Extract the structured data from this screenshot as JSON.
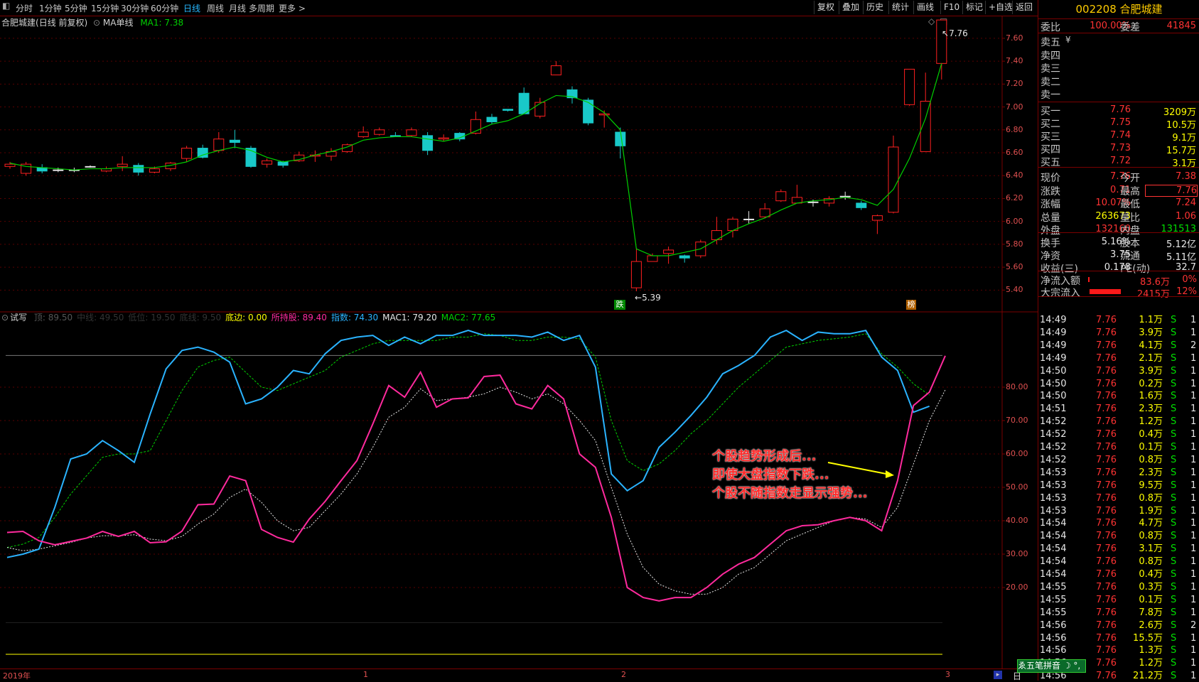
{
  "toolbar": {
    "tabs": [
      "分时",
      "1分钟",
      "5分钟",
      "15分钟",
      "30分钟",
      "60分钟",
      "日线",
      "周线",
      "月线",
      "多周期",
      "更多 >"
    ],
    "active_tab": "日线",
    "right_buttons": [
      "复权",
      "叠加",
      "历史",
      "统计",
      "画线",
      "F10",
      "标记",
      "+自选",
      "返回"
    ]
  },
  "main_chart": {
    "stock_name": "合肥城建",
    "period_label": "(日线 前复权)",
    "ma_label": "MA单线",
    "ma_value_label": "MA1: 7.38",
    "price_ticks": [
      "7.60",
      "7.40",
      "7.20",
      "7.00",
      "6.80",
      "6.60",
      "6.40",
      "6.20",
      "6.00",
      "5.80",
      "5.60",
      "5.40"
    ],
    "high_marker": "7.76",
    "low_marker": "5.39",
    "badge_down": "跌",
    "badge_rank": "榜",
    "colors": {
      "up": "#ff2020",
      "down": "#19c9c9",
      "ma": "#00d000"
    }
  },
  "indicator": {
    "name": "试写",
    "legend": [
      {
        "label": "顶: 89.50",
        "color": "#555555"
      },
      {
        "label": "中线: 49.50",
        "color": "#333333"
      },
      {
        "label": "低位: 19.50",
        "color": "#333333"
      },
      {
        "label": "底线: 9.50",
        "color": "#333333"
      },
      {
        "label": "底边: 0.00",
        "color": "#ffff00"
      },
      {
        "label": "所持股: 89.40",
        "color": "#ff2a9d"
      },
      {
        "label": "指数: 74.30",
        "color": "#2ab3ff"
      },
      {
        "label": "MAC1: 79.20",
        "color": "#e8e8e8"
      },
      {
        "label": "MAC2: 77.65",
        "color": "#00d000"
      }
    ],
    "ticks": [
      "80.00",
      "70.00",
      "60.00",
      "50.00",
      "40.00",
      "30.00",
      "20.00"
    ],
    "annotation": [
      "个股趋势形成后...",
      "即使大盘指数下跌...",
      "个股不随指数走显示强势..."
    ]
  },
  "x_axis": {
    "labels": [
      "2019年",
      "1",
      "2",
      "3"
    ],
    "day_button": "日"
  },
  "quote": {
    "title": "002208 合肥城建",
    "weibi": {
      "label": "委比",
      "value": "100.00%",
      "diff_label": "委差",
      "diff": "41845"
    },
    "sell": [
      {
        "label": "卖五",
        "extra": "¥"
      },
      {
        "label": "卖四"
      },
      {
        "label": "卖三"
      },
      {
        "label": "卖二"
      },
      {
        "label": "卖一"
      }
    ],
    "buy": [
      {
        "label": "买一",
        "price": "7.76",
        "vol": "3209万"
      },
      {
        "label": "买二",
        "price": "7.75",
        "vol": "10.5万"
      },
      {
        "label": "买三",
        "price": "7.74",
        "vol": "9.1万"
      },
      {
        "label": "买四",
        "price": "7.73",
        "vol": "15.7万"
      },
      {
        "label": "买五",
        "price": "7.72",
        "vol": "3.1万"
      }
    ],
    "stats": [
      {
        "l1": "现价",
        "v1": "7.76",
        "c1": "red",
        "l2": "今开",
        "v2": "7.38",
        "c2": "red"
      },
      {
        "l1": "涨跌",
        "v1": "0.71",
        "c1": "red",
        "l2": "最高",
        "v2": "7.76",
        "c2": "red"
      },
      {
        "l1": "涨幅",
        "v1": "10.07%",
        "c1": "red",
        "l2": "最低",
        "v2": "7.24",
        "c2": "red"
      },
      {
        "l1": "总量",
        "v1": "263673",
        "c1": "yellow",
        "l2": "量比",
        "v2": "1.06",
        "c2": "red"
      },
      {
        "l1": "外盘",
        "v1": "132160",
        "c1": "red",
        "l2": "内盘",
        "v2": "131513",
        "c2": "green"
      }
    ],
    "stats2": [
      {
        "l1": "换手",
        "v1": "5.16%",
        "l2": "股本",
        "v2": "5.12亿"
      },
      {
        "l1": "净资",
        "v1": "3.75",
        "l2": "流通",
        "v2": "5.11亿"
      },
      {
        "l1": "收益(三)",
        "v1": "0.178",
        "l2": "PE(动)",
        "v2": "32.7"
      }
    ],
    "flow": [
      {
        "label": "净流入额",
        "value": "83.6万",
        "pct": "0%"
      },
      {
        "label": "大宗流入",
        "value": "2415万",
        "pct": "12%"
      }
    ],
    "ticks_header_button": "五笔拼音",
    "trades": [
      [
        "14:49",
        "7.76",
        "1.1万",
        "S",
        "1"
      ],
      [
        "14:49",
        "7.76",
        "3.9万",
        "S",
        "1"
      ],
      [
        "14:49",
        "7.76",
        "4.1万",
        "S",
        "2"
      ],
      [
        "14:49",
        "7.76",
        "2.1万",
        "S",
        "1"
      ],
      [
        "14:50",
        "7.76",
        "3.9万",
        "S",
        "1"
      ],
      [
        "14:50",
        "7.76",
        "0.2万",
        "S",
        "1"
      ],
      [
        "14:50",
        "7.76",
        "1.6万",
        "S",
        "1"
      ],
      [
        "14:51",
        "7.76",
        "2.3万",
        "S",
        "1"
      ],
      [
        "14:52",
        "7.76",
        "1.2万",
        "S",
        "1"
      ],
      [
        "14:52",
        "7.76",
        "0.4万",
        "S",
        "1"
      ],
      [
        "14:52",
        "7.76",
        "0.1万",
        "S",
        "1"
      ],
      [
        "14:52",
        "7.76",
        "0.8万",
        "S",
        "1"
      ],
      [
        "14:53",
        "7.76",
        "2.3万",
        "S",
        "1"
      ],
      [
        "14:53",
        "7.76",
        "9.5万",
        "S",
        "1"
      ],
      [
        "14:53",
        "7.76",
        "0.8万",
        "S",
        "1"
      ],
      [
        "14:53",
        "7.76",
        "1.9万",
        "S",
        "1"
      ],
      [
        "14:54",
        "7.76",
        "4.7万",
        "S",
        "1"
      ],
      [
        "14:54",
        "7.76",
        "0.8万",
        "S",
        "1"
      ],
      [
        "14:54",
        "7.76",
        "3.1万",
        "S",
        "1"
      ],
      [
        "14:54",
        "7.76",
        "0.8万",
        "S",
        "1"
      ],
      [
        "14:54",
        "7.76",
        "0.4万",
        "S",
        "1"
      ],
      [
        "14:55",
        "7.76",
        "0.3万",
        "S",
        "1"
      ],
      [
        "14:55",
        "7.76",
        "0.1万",
        "S",
        "1"
      ],
      [
        "14:55",
        "7.76",
        "7.8万",
        "S",
        "1"
      ],
      [
        "14:56",
        "7.76",
        "2.6万",
        "S",
        "2"
      ],
      [
        "14:56",
        "7.76",
        "15.5万",
        "S",
        "1"
      ],
      [
        "14:56",
        "7.76",
        "1.3万",
        "S",
        "1"
      ],
      [
        "14:56",
        "7.76",
        "1.2万",
        "S",
        "1"
      ],
      [
        "14:56",
        "7.76",
        "21.2万",
        "S",
        "1"
      ]
    ]
  },
  "chart_data": {
    "type": "line",
    "title": "合肥城建",
    "candles": [
      [
        6.48,
        6.5,
        6.52,
        6.46
      ],
      [
        6.42,
        6.5,
        6.52,
        6.4
      ],
      [
        6.47,
        6.44,
        6.5,
        6.42
      ],
      [
        6.45,
        6.45,
        6.47,
        6.43
      ],
      [
        6.45,
        6.45,
        6.47,
        6.43
      ],
      [
        6.48,
        6.48,
        6.49,
        6.47
      ],
      [
        6.44,
        6.46,
        6.48,
        6.43
      ],
      [
        6.48,
        6.5,
        6.57,
        6.44
      ],
      [
        6.49,
        6.43,
        6.51,
        6.4
      ],
      [
        6.43,
        6.46,
        6.48,
        6.42
      ],
      [
        6.46,
        6.51,
        6.52,
        6.44
      ],
      [
        6.55,
        6.64,
        6.66,
        6.52
      ],
      [
        6.64,
        6.56,
        6.67,
        6.55
      ],
      [
        6.62,
        6.72,
        6.78,
        6.6
      ],
      [
        6.71,
        6.69,
        6.8,
        6.64
      ],
      [
        6.64,
        6.48,
        6.66,
        6.47
      ],
      [
        6.5,
        6.53,
        6.55,
        6.47
      ],
      [
        6.52,
        6.49,
        6.53,
        6.47
      ],
      [
        6.53,
        6.58,
        6.61,
        6.52
      ],
      [
        6.57,
        6.58,
        6.62,
        6.52
      ],
      [
        6.57,
        6.61,
        6.64,
        6.53
      ],
      [
        6.61,
        6.67,
        6.68,
        6.6
      ],
      [
        6.74,
        6.78,
        6.83,
        6.73
      ],
      [
        6.76,
        6.8,
        6.82,
        6.75
      ],
      [
        6.75,
        6.74,
        6.78,
        6.74
      ],
      [
        6.75,
        6.8,
        6.82,
        6.74
      ],
      [
        6.75,
        6.62,
        6.78,
        6.58
      ],
      [
        6.72,
        6.73,
        6.76,
        6.7
      ],
      [
        6.77,
        6.72,
        6.78,
        6.7
      ],
      [
        6.77,
        6.89,
        6.96,
        6.76
      ],
      [
        6.91,
        6.87,
        6.94,
        6.85
      ],
      [
        6.98,
        6.97,
        6.98,
        6.96
      ],
      [
        7.12,
        6.94,
        7.17,
        6.94
      ],
      [
        6.92,
        7.04,
        7.08,
        6.9
      ],
      [
        7.28,
        7.36,
        7.4,
        7.29
      ],
      [
        7.15,
        7.08,
        7.18,
        7.03
      ],
      [
        7.06,
        6.86,
        7.08,
        6.84
      ],
      [
        6.93,
        6.94,
        6.97,
        6.82
      ],
      [
        6.78,
        6.66,
        6.82,
        6.55
      ],
      [
        5.42,
        5.65,
        5.76,
        5.39
      ],
      [
        5.65,
        5.7,
        5.72,
        5.67
      ],
      [
        5.72,
        5.75,
        5.78,
        5.63
      ],
      [
        5.7,
        5.68,
        5.71,
        5.64
      ],
      [
        5.7,
        5.82,
        5.84,
        5.68
      ],
      [
        5.84,
        5.92,
        6.04,
        5.8
      ],
      [
        5.92,
        6.02,
        6.04,
        5.86
      ],
      [
        6.02,
        6.02,
        6.09,
        5.98
      ],
      [
        6.04,
        6.11,
        6.16,
        6.03
      ],
      [
        6.18,
        6.26,
        6.28,
        6.17
      ],
      [
        6.16,
        6.21,
        6.32,
        6.16
      ],
      [
        6.17,
        6.17,
        6.19,
        6.13
      ],
      [
        6.16,
        6.2,
        6.22,
        6.13
      ],
      [
        6.22,
        6.22,
        6.26,
        6.19
      ],
      [
        6.16,
        6.12,
        6.18,
        6.1
      ],
      [
        6.01,
        6.05,
        6.06,
        5.89
      ],
      [
        6.08,
        6.65,
        6.75,
        6.07
      ],
      [
        7.02,
        7.33,
        7.33,
        7.01
      ],
      [
        6.61,
        7.05,
        7.3,
        6.61
      ],
      [
        7.38,
        7.76,
        7.76,
        7.24
      ]
    ],
    "ma": [
      6.51,
      6.48,
      6.47,
      6.46,
      6.45,
      6.46,
      6.46,
      6.47,
      6.47,
      6.47,
      6.49,
      6.52,
      6.58,
      6.62,
      6.65,
      6.62,
      6.56,
      6.52,
      6.54,
      6.58,
      6.61,
      6.65,
      6.71,
      6.73,
      6.74,
      6.74,
      6.72,
      6.7,
      6.73,
      6.79,
      6.85,
      6.88,
      6.94,
      7.03,
      7.1,
      7.09,
      7.04,
      6.95,
      6.8,
      5.76,
      5.7,
      5.7,
      5.73,
      5.76,
      5.84,
      5.92,
      5.98,
      6.03,
      6.1,
      6.16,
      6.18,
      6.19,
      6.21,
      6.19,
      6.14,
      6.28,
      6.55,
      6.9,
      7.38
    ],
    "series": [
      {
        "name": "所持股",
        "values": [
          36.5,
          36.8,
          34,
          32.8,
          33.8,
          34.8,
          36.8,
          35.3,
          36.8,
          33.4,
          33.7,
          36.9,
          44.8,
          45,
          53.4,
          52,
          37.4,
          35,
          33.6,
          40.5,
          45.8,
          52,
          58,
          69,
          80.5,
          77,
          84.5,
          74,
          76.5,
          76.8,
          83.2,
          83.6,
          75,
          73.5,
          80.5,
          76.5,
          60,
          56,
          41,
          20,
          17,
          16,
          17,
          17,
          20,
          24,
          27,
          29,
          33,
          37,
          38.5,
          38.8,
          40,
          41,
          40,
          37,
          52,
          74.5,
          78.5,
          89.4
        ]
      },
      {
        "name": "指数",
        "values": [
          29,
          30,
          31.5,
          44,
          58.5,
          60,
          64,
          61,
          57.5,
          72,
          85.5,
          91,
          92,
          90.5,
          87.5,
          75,
          76.5,
          80,
          85,
          84,
          90,
          94,
          95,
          95.5,
          92.5,
          95,
          93,
          95.5,
          95.5,
          97,
          95.5,
          95.5,
          95.5,
          95,
          96.5,
          94,
          95.5,
          86,
          54,
          49,
          52,
          62,
          66.5,
          71.5,
          77,
          84,
          86.5,
          89.5,
          95,
          97,
          94,
          96.5,
          96,
          96,
          97,
          89,
          85,
          72.5,
          74.3
        ]
      }
    ],
    "mac1": [
      32,
      31,
      31.5,
      32.5,
      33.5,
      34.8,
      35.5,
      35.5,
      35.8,
      34.5,
      34,
      35.3,
      39,
      42,
      47,
      49.5,
      45.5,
      40,
      37,
      38,
      43,
      48,
      54,
      62,
      71,
      74,
      79.5,
      76,
      76.5,
      77,
      78,
      80,
      78.5,
      76.5,
      78,
      75,
      70,
      64,
      50,
      36,
      26,
      21,
      19,
      18,
      18,
      20,
      24,
      26,
      30,
      34,
      36,
      38,
      40,
      41,
      40.5,
      38,
      44,
      57,
      70,
      79.2
    ],
    "mac2": [
      32,
      33,
      35,
      41,
      48,
      53.5,
      59,
      60,
      60,
      61,
      70,
      79,
      86,
      88,
      89,
      84.5,
      80,
      79,
      81,
      83,
      85,
      89,
      91,
      93,
      94,
      94,
      94,
      94,
      95,
      95,
      96,
      95.5,
      94,
      94,
      95,
      95,
      94.5,
      89,
      70,
      58,
      55,
      57,
      61,
      66,
      70,
      75,
      80,
      84,
      88,
      92,
      93,
      94,
      94.5,
      95,
      96,
      90,
      86,
      81,
      77.65
    ]
  }
}
